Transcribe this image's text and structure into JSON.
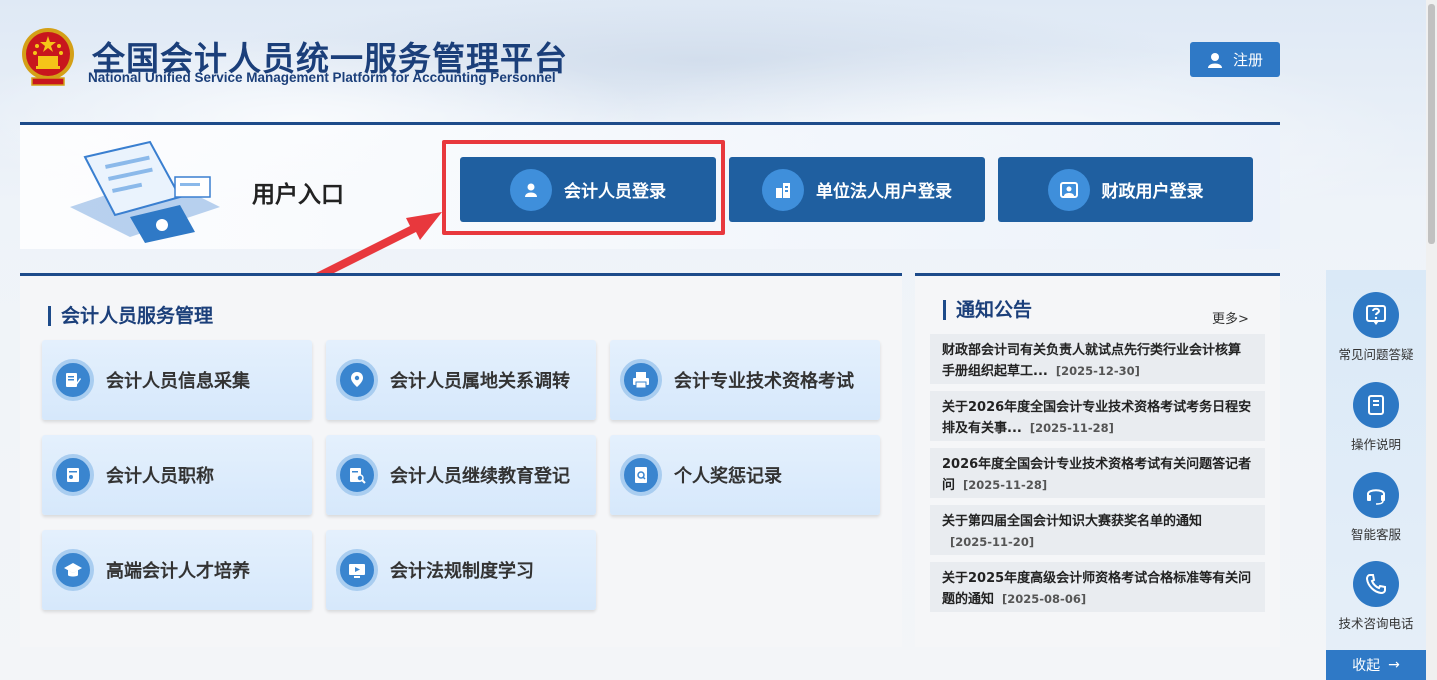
{
  "header": {
    "title": "全国会计人员统一服务管理平台",
    "subtitle": "National Unified Service Management Platform for Accounting Personnel",
    "register_label": "注册"
  },
  "entry": {
    "title": "用户入口",
    "buttons": [
      {
        "label": "会计人员登录",
        "icon": "user-icon"
      },
      {
        "label": "单位法人用户登录",
        "icon": "building-icon"
      },
      {
        "label": "财政用户登录",
        "icon": "portrait-icon"
      }
    ]
  },
  "services": {
    "title": "会计人员服务管理",
    "items": [
      {
        "label": "会计人员信息采集",
        "icon": "edit-doc-icon"
      },
      {
        "label": "会计人员属地关系调转",
        "icon": "location-icon"
      },
      {
        "label": "会计专业技术资格考试",
        "icon": "printer-icon"
      },
      {
        "label": "会计人员职称",
        "icon": "certificate-icon"
      },
      {
        "label": "会计人员继续教育登记",
        "icon": "doc-search-icon"
      },
      {
        "label": "个人奖惩记录",
        "icon": "record-search-icon"
      },
      {
        "label": "高端会计人才培养",
        "icon": "graduation-cap-icon"
      },
      {
        "label": "会计法规制度学习",
        "icon": "video-play-icon"
      }
    ]
  },
  "notices": {
    "title": "通知公告",
    "more": "更多>",
    "items": [
      {
        "text": "财政部会计司有关负责人就试点先行类行业会计核算手册组织起草工...",
        "date": "[2025-12-30]"
      },
      {
        "text": "关于2026年度全国会计专业技术资格考试考务日程安排及有关事...",
        "date": "[2025-11-28]"
      },
      {
        "text": "2026年度全国会计专业技术资格考试有关问题答记者问",
        "date": "[2025-11-28]"
      },
      {
        "text": "关于第四届全国会计知识大赛获奖名单的通知",
        "date": "[2025-11-20]"
      },
      {
        "text": "关于2025年度高级会计师资格考试合格标准等有关问题的通知",
        "date": "[2025-08-06]"
      }
    ]
  },
  "float_bar": {
    "items": [
      {
        "label": "常见问题答疑",
        "icon": "question-icon"
      },
      {
        "label": "操作说明",
        "icon": "manual-icon"
      },
      {
        "label": "智能客服",
        "icon": "headset-icon"
      },
      {
        "label": "技术咨询电话",
        "icon": "phone-icon"
      }
    ],
    "collapse_label": "收起",
    "collapse_arrow": "→"
  },
  "colors": {
    "primary": "#1f5fa0",
    "accent": "#2f79c6",
    "highlight": "#e8383d",
    "title": "#1b3f7a"
  }
}
